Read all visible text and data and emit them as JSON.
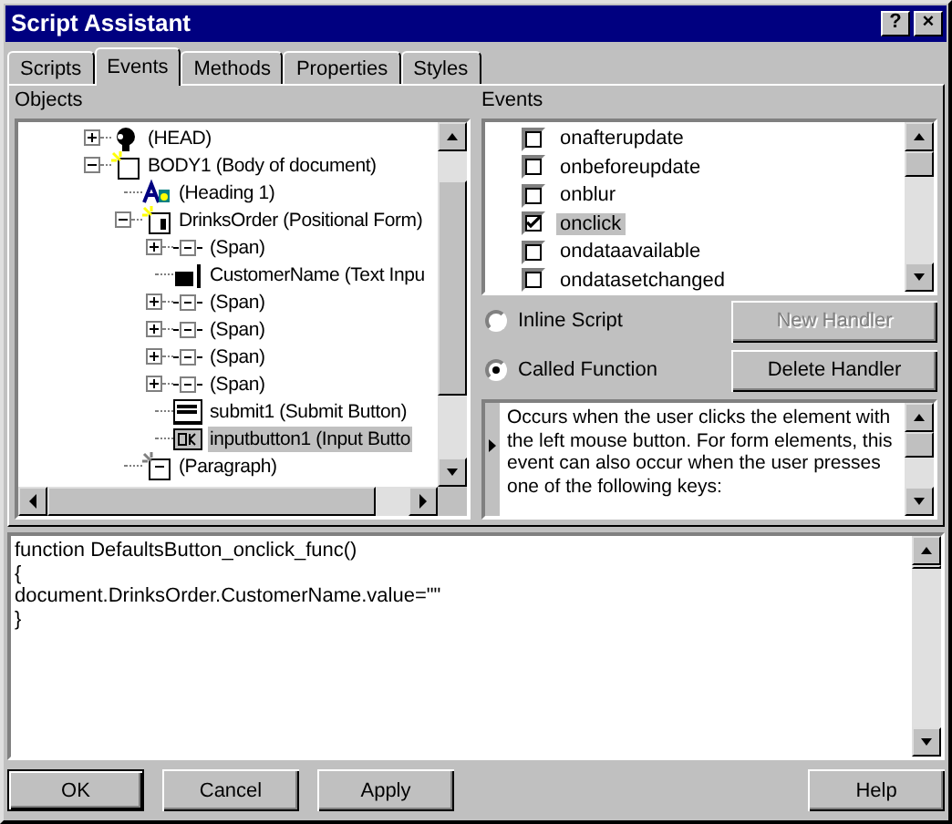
{
  "window": {
    "title": "Script Assistant",
    "help_button": "?",
    "close_button": "×"
  },
  "tabs": [
    {
      "label": "Scripts",
      "selected": false
    },
    {
      "label": "Events",
      "selected": true
    },
    {
      "label": "Methods",
      "selected": false
    },
    {
      "label": "Properties",
      "selected": false
    },
    {
      "label": "Styles",
      "selected": false
    }
  ],
  "objects": {
    "label": "Objects",
    "tree": [
      {
        "label": "(HEAD)",
        "kind": "head",
        "expanded": false,
        "selected": false
      },
      {
        "label": "BODY1 (Body of document)",
        "kind": "body",
        "expanded": true,
        "selected": false,
        "children": [
          {
            "label": "(Heading 1)",
            "kind": "heading",
            "selected": false
          },
          {
            "label": "DrinksOrder (Positional Form)",
            "kind": "form",
            "expanded": true,
            "selected": false,
            "children": [
              {
                "label": "(Span)",
                "kind": "span",
                "expanded": false,
                "selected": false
              },
              {
                "label": "CustomerName (Text Inpu",
                "kind": "textinput",
                "selected": false
              },
              {
                "label": "(Span)",
                "kind": "span",
                "expanded": false,
                "selected": false
              },
              {
                "label": "(Span)",
                "kind": "span",
                "expanded": false,
                "selected": false
              },
              {
                "label": "(Span)",
                "kind": "span",
                "expanded": false,
                "selected": false
              },
              {
                "label": "(Span)",
                "kind": "span",
                "expanded": false,
                "selected": false
              },
              {
                "label": "submit1 (Submit Button)",
                "kind": "submit",
                "selected": false
              },
              {
                "label": "inputbutton1 (Input Butto",
                "kind": "okbutton",
                "selected": true
              }
            ]
          },
          {
            "label": "(Paragraph)",
            "kind": "paragraph",
            "selected": false
          }
        ]
      }
    ]
  },
  "events": {
    "label": "Events",
    "items": [
      {
        "label": "onafterupdate",
        "checked": false,
        "selected": false
      },
      {
        "label": "onbeforeupdate",
        "checked": false,
        "selected": false
      },
      {
        "label": "onblur",
        "checked": false,
        "selected": false
      },
      {
        "label": "onclick",
        "checked": true,
        "selected": true
      },
      {
        "label": "ondataavailable",
        "checked": false,
        "selected": false
      },
      {
        "label": "ondatasetchanged",
        "checked": false,
        "selected": false
      }
    ]
  },
  "script_types": [
    {
      "label": "Inline Script",
      "selected": false
    },
    {
      "label": "Called Function",
      "selected": true
    }
  ],
  "handler_buttons": [
    {
      "label": "New Handler",
      "disabled": true
    },
    {
      "label": "Delete Handler",
      "disabled": false
    }
  ],
  "description": "Occurs when the user clicks the element with the left mouse button. For form elements, this event can also occur when the user presses one of the following keys:",
  "code_lines": [
    "function DefaultsButton_onclick_func()",
    "{",
    "document.DrinksOrder.CustomerName.value=\"\"",
    "}"
  ],
  "buttons": [
    {
      "label": "OK",
      "default": true
    },
    {
      "label": "Cancel",
      "default": false
    },
    {
      "label": "Apply",
      "default": false
    },
    {
      "label": "Help",
      "default": false
    }
  ]
}
